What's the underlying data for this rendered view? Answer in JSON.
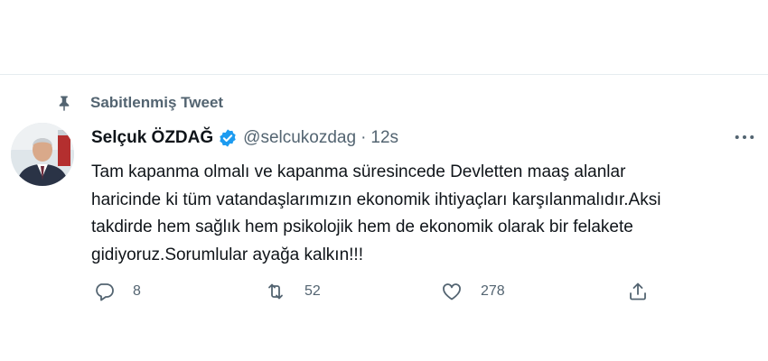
{
  "pinned": {
    "label": "Sabitlenmiş Tweet",
    "icon": "pin-icon"
  },
  "tweet": {
    "author": {
      "display_name": "Selçuk ÖZDAĞ",
      "handle": "@selcukozdag",
      "verified": true,
      "avatar": "avatar"
    },
    "separator": "·",
    "time": "12s",
    "text_lines": [
      "Tam kapanma olmalı ve kapanma süresincede Devletten maaş alanlar",
      "haricinde ki tüm vatandaşlarımızın ekonomik ihtiyaçları karşılanmalıdır.Aksi",
      "takdirde hem sağlık hem psikolojik hem de ekonomik olarak bir felakete",
      "gidiyoruz.Sorumlular ayağa kalkın!!!"
    ],
    "actions": {
      "reply": {
        "icon": "reply-icon",
        "count": "8"
      },
      "retweet": {
        "icon": "retweet-icon",
        "count": "52"
      },
      "like": {
        "icon": "heart-icon",
        "count": "278"
      },
      "share": {
        "icon": "share-icon",
        "count": ""
      }
    }
  },
  "colors": {
    "text_primary": "#0f1419",
    "text_secondary": "#536471",
    "verified_blue": "#1d9bf0",
    "divider": "#e6ecf0"
  }
}
